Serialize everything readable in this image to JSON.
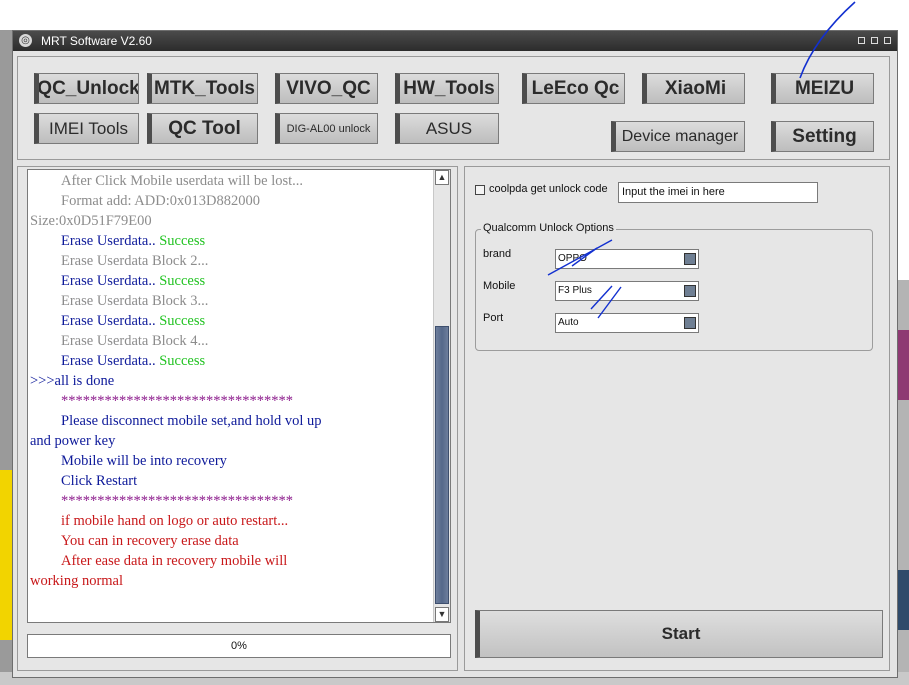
{
  "window": {
    "title": "MRT Software V2.60"
  },
  "toolbar": {
    "buttons": [
      {
        "label": "QC_Unlock"
      },
      {
        "label": "MTK_Tools"
      },
      {
        "label": "VIVO_QC"
      },
      {
        "label": "HW_Tools"
      },
      {
        "label": "LeEco Qc"
      },
      {
        "label": "XiaoMi"
      },
      {
        "label": "MEIZU"
      },
      {
        "label": "IMEI Tools"
      },
      {
        "label": "QC Tool"
      },
      {
        "label": "DIG-AL00 unlock"
      },
      {
        "label": "ASUS"
      },
      {
        "label": "Device manager"
      },
      {
        "label": "Setting"
      }
    ]
  },
  "log": {
    "lines": [
      {
        "text": "After Click Mobile userdata will be lost...",
        "color": "gray",
        "indent": true
      },
      {
        "text": "Format add: ADD:0x013D882000",
        "color": "gray",
        "indent": true
      },
      {
        "text": "Size:0x0D51F79E00",
        "color": "gray",
        "indent": false
      },
      {
        "text": "Erase Userdata.. ",
        "suffix": "Success",
        "color": "navy",
        "indent": true
      },
      {
        "text": "Erase Userdata Block 2...",
        "color": "gray",
        "indent": true
      },
      {
        "text": "Erase Userdata.. ",
        "suffix": "Success",
        "color": "navy",
        "indent": true
      },
      {
        "text": "Erase Userdata Block 3...",
        "color": "gray",
        "indent": true
      },
      {
        "text": "Erase Userdata.. ",
        "suffix": "Success",
        "color": "navy",
        "indent": true
      },
      {
        "text": "Erase Userdata Block 4...",
        "color": "gray",
        "indent": true
      },
      {
        "text": "Erase Userdata.. ",
        "suffix": "Success",
        "color": "navy",
        "indent": true
      },
      {
        "text": ">>>all is done",
        "color": "navy",
        "indent": false
      },
      {
        "text": "********************************",
        "color": "purple",
        "indent": true
      },
      {
        "text": "Please disconnect mobile set,and hold vol up",
        "color": "navy",
        "indent": true
      },
      {
        "text": "and power key",
        "color": "navy",
        "indent": false
      },
      {
        "text": "Mobile will be into recovery",
        "color": "navy",
        "indent": true
      },
      {
        "text": "Click Restart",
        "color": "navy",
        "indent": true
      },
      {
        "text": "********************************",
        "color": "purple",
        "indent": true
      },
      {
        "text": "if mobile hand on logo or auto restart...",
        "color": "red",
        "indent": true
      },
      {
        "text": "You can in recovery erase data",
        "color": "red",
        "indent": true
      },
      {
        "text": "After ease data in recovery mobile will",
        "color": "red",
        "indent": true
      },
      {
        "text": "working normal",
        "color": "red",
        "indent": false
      }
    ],
    "scroll_up_icon": "chevron-up-icon",
    "scroll_down_icon": "chevron-down-icon"
  },
  "progress": {
    "text": "0%",
    "value": 0
  },
  "coolpad": {
    "checkbox_label": "coolpda get unlock code",
    "checked": false,
    "imei_value": "Input the imei in here"
  },
  "qualcomm": {
    "group_title": "Qualcomm Unlock Options",
    "brand_label": "brand",
    "brand_value": "OPPO",
    "mobile_label": "Mobile",
    "mobile_value": "F3 Plus",
    "port_label": "Port",
    "port_value": "Auto"
  },
  "start_label": "Start",
  "colors": {
    "titlebar": "#2c2c2c",
    "log_gray": "#8c8c8c",
    "log_navy": "#0e1a9a",
    "log_green": "#22c322",
    "log_purple": "#8b1a8b",
    "log_red": "#c8181a",
    "annotation_pen": "#1230d0"
  }
}
